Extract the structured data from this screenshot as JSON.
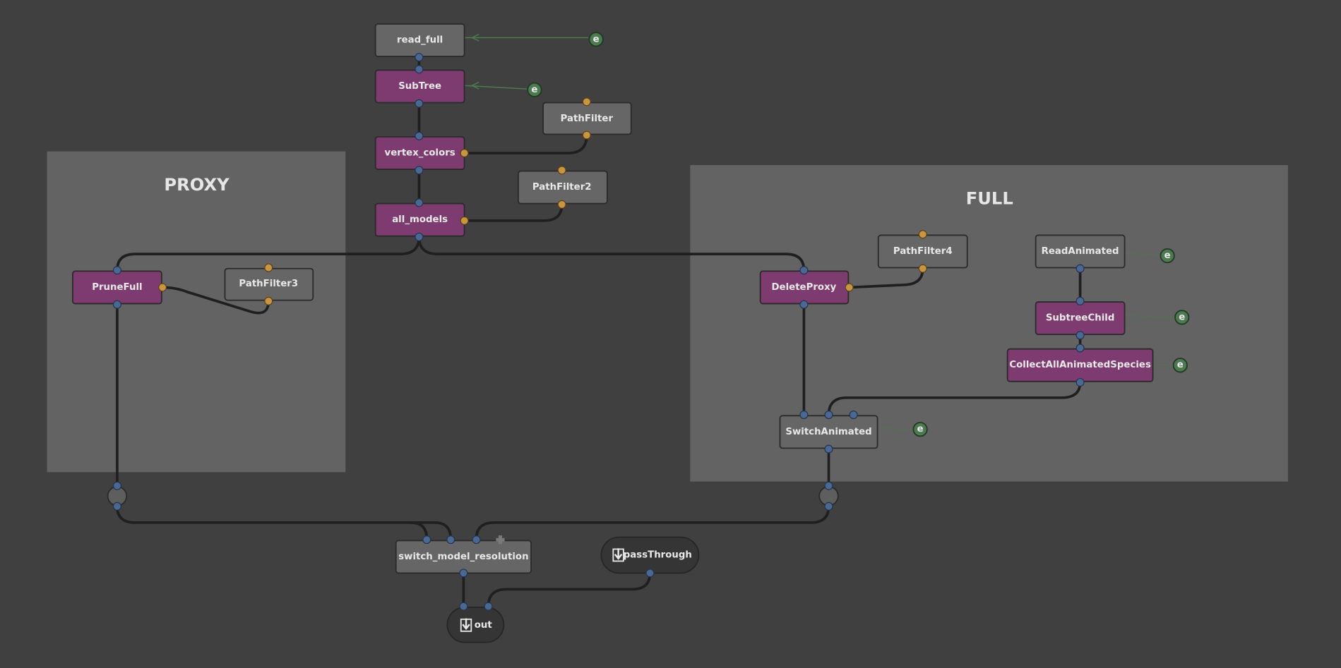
{
  "colors": {
    "background": "#404040",
    "backdrop": "#636363",
    "node_gray": "#666666",
    "node_purple": "#7d3b70",
    "plug_scene": "#4a6894",
    "plug_filter": "#c8963e",
    "expression": "#4e7a52"
  },
  "backdrops": [
    {
      "title": "PROXY"
    },
    {
      "title": "FULL"
    }
  ],
  "nodes": {
    "read_full": "read_full",
    "subtree": "SubTree",
    "vertex_colors": "vertex_colors",
    "all_models": "all_models",
    "pathfilter": "PathFilter",
    "pathfilter2": "PathFilter2",
    "prunefull": "PruneFull",
    "pathfilter3": "PathFilter3",
    "deleteproxy": "DeleteProxy",
    "pathfilter4": "PathFilter4",
    "readanimated": "ReadAnimated",
    "subtreechild": "SubtreeChild",
    "collect": "CollectAllAnimatedSpecies",
    "switchanimated": "SwitchAnimated",
    "switch_model": "switch_model_resolution",
    "passthrough": "passThrough",
    "out": "out"
  },
  "expression_label": "e",
  "icons": {
    "box_out": "box-out-icon",
    "add_plug": "plus-icon",
    "expression": "expression-icon"
  }
}
